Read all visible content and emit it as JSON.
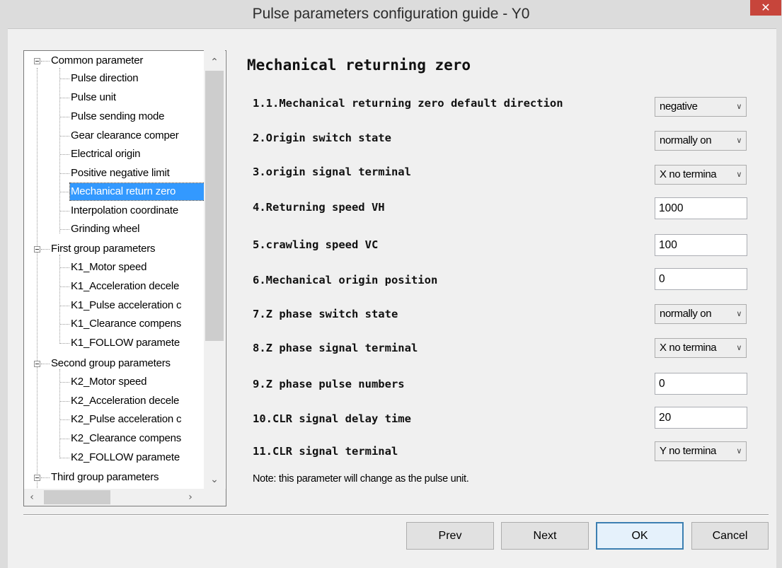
{
  "window": {
    "title": "Pulse parameters configuration guide - Y0",
    "close_glyph": "✕"
  },
  "tree": {
    "groups": [
      {
        "label": "Common parameter",
        "children": [
          "Pulse direction",
          "Pulse unit",
          "Pulse sending mode",
          "Gear clearance comper",
          "Electrical origin",
          "Positive negative limit",
          "Mechanical return zero",
          "Interpolation coordinate",
          "Grinding wheel"
        ]
      },
      {
        "label": "First group parameters",
        "children": [
          "K1_Motor speed",
          "K1_Acceleration decele",
          "K1_Pulse acceleration c",
          "K1_Clearance compens",
          "K1_FOLLOW paramete"
        ]
      },
      {
        "label": "Second group parameters",
        "children": [
          "K2_Motor speed",
          "K2_Acceleration decele",
          "K2_Pulse acceleration c",
          "K2_Clearance compens",
          "K2_FOLLOW paramete"
        ]
      },
      {
        "label": "Third group parameters",
        "children": []
      }
    ],
    "selected": "Mechanical return zero"
  },
  "section": {
    "title": "Mechanical returning zero"
  },
  "params": [
    {
      "label": "1.1.Mechanical returning zero default direction",
      "type": "select",
      "value": "negative"
    },
    {
      "label": "2.Origin switch state",
      "type": "select",
      "value": "normally on"
    },
    {
      "label": "3.origin signal terminal",
      "type": "select",
      "value": "X no termina"
    },
    {
      "label": "4.Returning speed VH",
      "type": "text",
      "value": "1000"
    },
    {
      "label": "5.crawling speed VC",
      "type": "text",
      "value": "100"
    },
    {
      "label": "6.Mechanical origin position",
      "type": "text",
      "value": "0"
    },
    {
      "label": "7.Z phase switch state",
      "type": "select",
      "value": "normally on"
    },
    {
      "label": "8.Z phase signal terminal",
      "type": "select",
      "value": "X no termina"
    },
    {
      "label": "9.Z phase pulse numbers",
      "type": "text",
      "value": "0"
    },
    {
      "label": "10.CLR signal delay time",
      "type": "text",
      "value": "20"
    },
    {
      "label": "11.CLR signal terminal",
      "type": "select",
      "value": "Y no termina"
    }
  ],
  "note": "Note: this parameter will change as the pulse unit.",
  "buttons": {
    "prev": "Prev",
    "next": "Next",
    "ok": "OK",
    "cancel": "Cancel"
  },
  "colors": {
    "selection": "#3399ff",
    "close": "#c7453b"
  }
}
